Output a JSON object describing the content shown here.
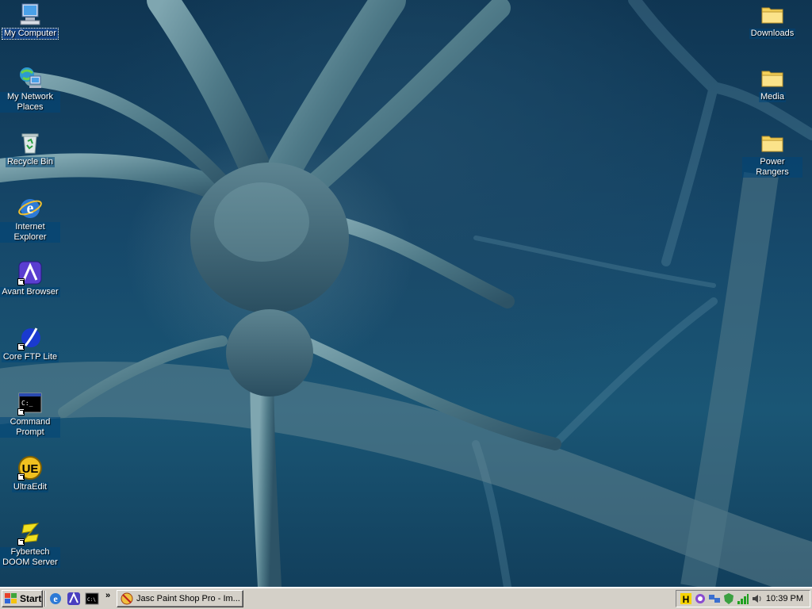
{
  "desktop_left": [
    {
      "id": "my-computer",
      "label": "My Computer",
      "icon": "my-computer-icon",
      "shortcut": false,
      "selected": true
    },
    {
      "id": "my-network-places",
      "label": "My Network Places",
      "icon": "network-places-icon",
      "shortcut": false
    },
    {
      "id": "recycle-bin",
      "label": "Recycle Bin",
      "icon": "recycle-bin-icon",
      "shortcut": false
    },
    {
      "id": "internet-explorer",
      "label": "Internet Explorer",
      "icon": "internet-explorer-icon",
      "shortcut": false
    },
    {
      "id": "avant-browser",
      "label": "Avant Browser",
      "icon": "avant-browser-icon",
      "shortcut": true
    },
    {
      "id": "core-ftp-lite",
      "label": "Core FTP Lite",
      "icon": "core-ftp-icon",
      "shortcut": true
    },
    {
      "id": "command-prompt",
      "label": "Command Prompt",
      "icon": "command-prompt-icon",
      "shortcut": true
    },
    {
      "id": "ultraedit",
      "label": "UltraEdit",
      "icon": "ultraedit-icon",
      "shortcut": true
    },
    {
      "id": "fybertech-doom-server",
      "label": "Fybertech DOOM Server",
      "icon": "doom-server-icon",
      "shortcut": true
    }
  ],
  "desktop_right": [
    {
      "id": "downloads",
      "label": "Downloads",
      "icon": "folder-icon"
    },
    {
      "id": "media",
      "label": "Media",
      "icon": "folder-icon"
    },
    {
      "id": "power-rangers",
      "label": "Power Rangers",
      "icon": "folder-icon"
    }
  ],
  "taskbar": {
    "start_label": "Start",
    "quick_launch": [
      "show-desktop-icon",
      "internet-explorer-icon",
      "avant-browser-icon",
      "command-prompt-icon"
    ],
    "chevron": "»",
    "tasks": [
      {
        "label": "Jasc Paint Shop Pro - Im...",
        "icon": "paint-shop-pro-icon"
      }
    ],
    "tray_icons": [
      "hamachi-icon",
      "messenger-icon",
      "network-icon",
      "shield-icon",
      "signal-icon",
      "speaker-icon"
    ],
    "clock": "10:39 PM"
  },
  "colors": {
    "taskbar_bg": "#d4d0c8",
    "desktop_bg": "#16486a",
    "folder": "#f5d25a"
  }
}
